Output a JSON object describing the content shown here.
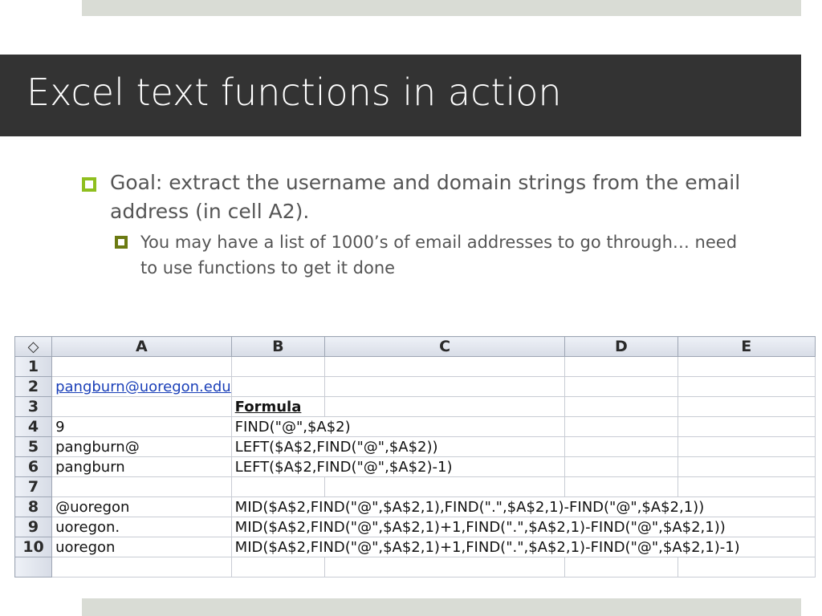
{
  "title": "Excel text functions in action",
  "bullets": {
    "level1": "Goal: extract the username and domain strings from the email address (in cell A2).",
    "level2": "You may have a list of 1000’s of email addresses to go through… need to use functions to get it done"
  },
  "spreadsheet": {
    "corner_icon": "◇",
    "columns": [
      "A",
      "B",
      "C",
      "D",
      "E"
    ],
    "rows": [
      {
        "num": "1",
        "a": "",
        "b": ""
      },
      {
        "num": "2",
        "a": "pangburn@uoregon.edu",
        "b": ""
      },
      {
        "num": "3",
        "a": "",
        "b": "Formula"
      },
      {
        "num": "4",
        "a": "9",
        "b": "FIND(\"@\",$A$2)"
      },
      {
        "num": "5",
        "a": "pangburn@",
        "b": "LEFT($A$2,FIND(\"@\",$A$2))"
      },
      {
        "num": "6",
        "a": "pangburn",
        "b": "LEFT($A$2,FIND(\"@\",$A$2)-1)"
      },
      {
        "num": "7",
        "a": "",
        "b": ""
      },
      {
        "num": "8",
        "a": "@uoregon",
        "b": "MID($A$2,FIND(\"@\",$A$2,1),FIND(\".\",$A$2,1)-FIND(\"@\",$A$2,1))"
      },
      {
        "num": "9",
        "a": "uoregon.",
        "b": "MID($A$2,FIND(\"@\",$A$2,1)+1,FIND(\".\",$A$2,1)-FIND(\"@\",$A$2,1))"
      },
      {
        "num": "10",
        "a": "uoregon",
        "b": "MID($A$2,FIND(\"@\",$A$2,1)+1,FIND(\".\",$A$2,1)-FIND(\"@\",$A$2,1)-1)"
      }
    ]
  },
  "colors": {
    "title_bar": "#333333",
    "accent_bullet": "#8fbf1f",
    "band": "#d9dcd5",
    "link": "#1a3fb8"
  }
}
